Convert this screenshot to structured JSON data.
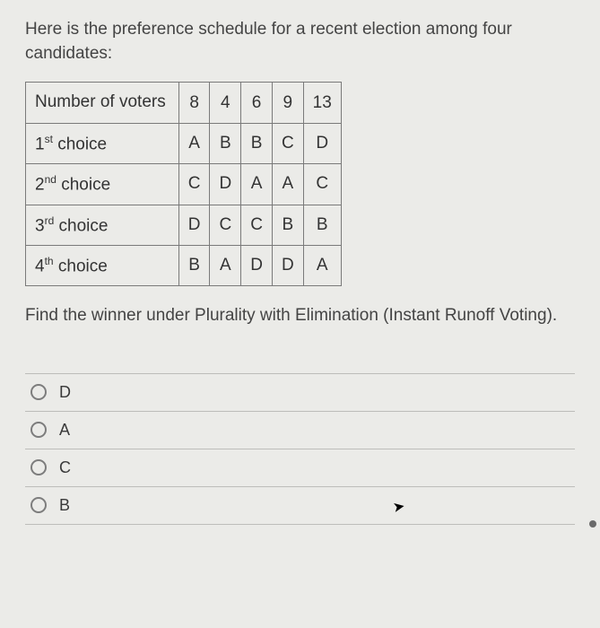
{
  "intro": "Here is the preference schedule for a recent election among four candidates:",
  "table": {
    "header_label": "Number of voters",
    "voter_counts": [
      "8",
      "4",
      "6",
      "9",
      "13"
    ],
    "rows": [
      {
        "label_pre": "1",
        "label_sup": "st",
        "label_post": " choice",
        "cells": [
          "A",
          "B",
          "B",
          "C",
          "D"
        ]
      },
      {
        "label_pre": "2",
        "label_sup": "nd",
        "label_post": " choice",
        "cells": [
          "C",
          "D",
          "A",
          "A",
          "C"
        ]
      },
      {
        "label_pre": "3",
        "label_sup": "rd",
        "label_post": " choice",
        "cells": [
          "D",
          "C",
          "C",
          "B",
          "B"
        ]
      },
      {
        "label_pre": "4",
        "label_sup": "th",
        "label_post": " choice",
        "cells": [
          "B",
          "A",
          "D",
          "D",
          "A"
        ]
      }
    ]
  },
  "prompt": "Find the winner under Plurality with Elimination (Instant Runoff Voting).",
  "options": [
    {
      "label": "D"
    },
    {
      "label": "A"
    },
    {
      "label": "C"
    },
    {
      "label": "B"
    }
  ]
}
